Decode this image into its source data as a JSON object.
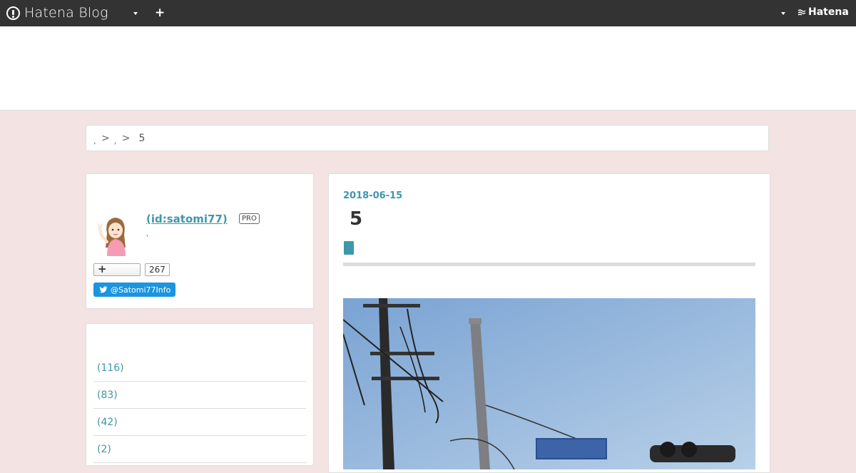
{
  "topbar": {
    "logo_text": "Hatena Blog",
    "plus": "+",
    "hatena_label": "Hatena"
  },
  "breadcrumb": {
    "sep1": ">",
    "sep2": ">",
    "current": "5"
  },
  "profile": {
    "name": " (id:satomi77)",
    "badge": "PRO",
    "note": "'",
    "subscribe_count": "267",
    "subscribe_plus": "+",
    "twitter_handle": "@Satomi77Info"
  },
  "categories": {
    "items": [
      {
        "label": "(116)"
      },
      {
        "label": " (83)"
      },
      {
        "label": "(42)"
      },
      {
        "label": "(2)"
      }
    ]
  },
  "article": {
    "date": "2018-06-15",
    "title": "5"
  },
  "colors": {
    "topbar": "#333333",
    "accent": "#3f97ab",
    "page_bg": "#f3e3e3",
    "twitter": "#1b95e0"
  },
  "icons": [
    "hatena-blog-logo-icon",
    "chevron-down-icon",
    "plus-icon",
    "hatena-wave-icon",
    "twitter-icon"
  ]
}
